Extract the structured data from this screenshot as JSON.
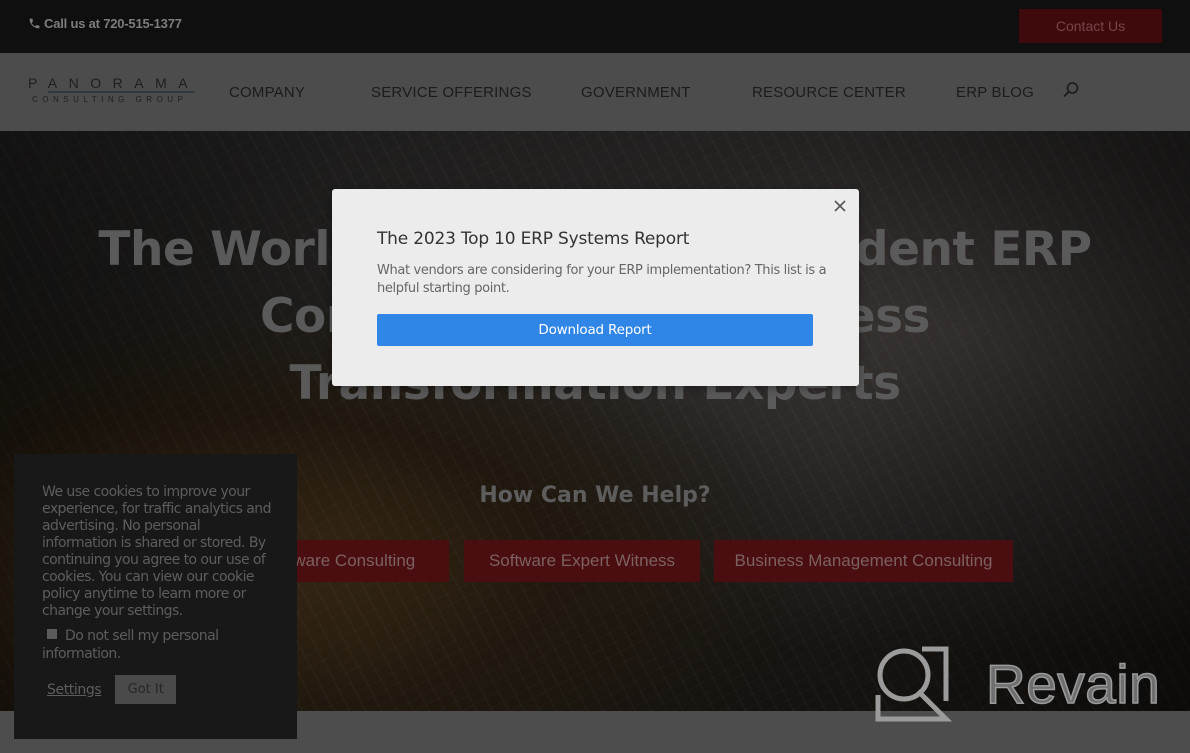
{
  "topbar": {
    "phone_icon": "phone-icon",
    "phone_text": "Call us at 720-515-1377",
    "contact_label": "Contact Us"
  },
  "logo": {
    "top": "PANORAMA",
    "bottom": "CONSULTING GROUP"
  },
  "nav": {
    "items": [
      {
        "label": "COMPANY"
      },
      {
        "label": "SERVICE OFFERINGS"
      },
      {
        "label": "GOVERNMENT"
      },
      {
        "label": "RESOURCE CENTER"
      },
      {
        "label": "ERP BLOG"
      }
    ],
    "search_icon": "search-icon"
  },
  "hero": {
    "title_lines": [
      "The World's Leading Independent ERP",
      "Consultants and Business",
      "Transformation Experts"
    ],
    "help_title": "How Can We Help?",
    "services": [
      {
        "label": "ERP Software Consulting"
      },
      {
        "label": "Software Expert Witness"
      },
      {
        "label": "Business Management Consulting"
      }
    ]
  },
  "modal": {
    "title": "The 2023 Top 10 ERP Systems Report",
    "description": "What vendors are considering for your ERP implementation? This list is a helpful starting point.",
    "button_label": "Download Report",
    "close_icon": "close-icon",
    "button_color": "#2f86e6"
  },
  "cookie": {
    "text": "We use cookies to improve your experience, for traffic analytics and advertising. No personal information is shared or stored. By continuing you agree to our use of cookies. You can view our cookie policy anytime to learn more or change your settings.",
    "do_not_sell_label": "Do not sell my personal information.",
    "do_not_sell_checked": false,
    "settings_label": "Settings",
    "got_it_label": "Got It"
  },
  "watermark": {
    "text": "Revain"
  }
}
